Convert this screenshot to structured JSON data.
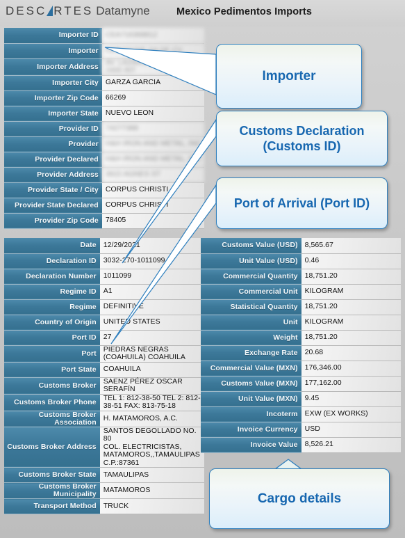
{
  "header": {
    "logo_primary": "DESC",
    "logo_triangle": "A",
    "logo_primary_tail": "RTES",
    "logo_secondary": "Datamyne",
    "title": "Mexico Pedimentos Imports"
  },
  "table_importer": {
    "rows": [
      {
        "label": "Importer ID",
        "value": "CEA716368812",
        "redacted": true
      },
      {
        "label": "Importer",
        "value": "CERADYNE SA DE CV",
        "redacted": true
      },
      {
        "label": "Importer Address",
        "value": "AV. LAZARO CARDENAS 2400 INT",
        "redacted": true
      },
      {
        "label": "Importer City",
        "value": "GARZA GARCIA",
        "redacted": false
      },
      {
        "label": "Importer Zip Code",
        "value": "66269",
        "redacted": false
      },
      {
        "label": "Importer State",
        "value": "NUEVO LEON",
        "redacted": false
      },
      {
        "label": "Provider ID",
        "value": "74277388",
        "redacted": true
      },
      {
        "label": "Provider",
        "value": "H&H IRON AND METAL, INC",
        "redacted": true
      },
      {
        "label": "Provider Declared",
        "value": "H&H IRON AND METAL, INC",
        "redacted": true
      },
      {
        "label": "Provider Address",
        "value": "3622 AGNES ST",
        "redacted": true
      },
      {
        "label": "Provider State / City",
        "value": "CORPUS CHRISTI",
        "redacted": false
      },
      {
        "label": "Provider State Declared",
        "value": "CORPUS CHRISTI",
        "redacted": false
      },
      {
        "label": "Provider Zip Code",
        "value": "78405",
        "redacted": false
      }
    ]
  },
  "table_declaration": {
    "rows": [
      {
        "label": "Date",
        "value": "12/29/2021"
      },
      {
        "label": "Declaration ID",
        "value": "3032-270-1011099"
      },
      {
        "label": "Declaration Number",
        "value": "1011099"
      },
      {
        "label": "Regime ID",
        "value": "A1"
      },
      {
        "label": "Regime",
        "value": "DEFINITIVE"
      },
      {
        "label": "Country of Origin",
        "value": "UNITED STATES"
      },
      {
        "label": "Port ID",
        "value": "27"
      },
      {
        "label": "Port",
        "value": "PIEDRAS NEGRAS\n(COAHUILA) COAHUILA"
      },
      {
        "label": "Port State",
        "value": "COAHUILA"
      },
      {
        "label": "Customs Broker",
        "value": "SAENZ PÉREZ OSCAR\nSERAFÍN"
      },
      {
        "label": "Customs Broker Phone",
        "value": "TEL 1: 812-38-50 TEL 2: 812-\n38-51 FAX: 813-75-18"
      },
      {
        "label": "Customs Broker Association",
        "value": "H. MATAMOROS, A.C."
      },
      {
        "label": "Customs Broker Address",
        "value": "SANTOS DEGOLLADO NO. 80\nCOL. ELECTRICISTAS,\nMATAMOROS,,TAMAULIPAS\nC.P.:87361"
      },
      {
        "label": "Customs Broker State",
        "value": "TAMAULIPAS"
      },
      {
        "label": "Customs Broker\nMunicipality",
        "value": "MATAMOROS"
      },
      {
        "label": "Transport Method",
        "value": "TRUCK"
      }
    ]
  },
  "table_cargo": {
    "rows": [
      {
        "label": "Customs Value (USD)",
        "value": "8,565.67"
      },
      {
        "label": "Unit Value (USD)",
        "value": "0.46"
      },
      {
        "label": "Commercial Quantity",
        "value": "18,751.20"
      },
      {
        "label": "Commercial Unit",
        "value": "KILOGRAM"
      },
      {
        "label": "Statistical Quantity",
        "value": "18,751.20"
      },
      {
        "label": "Unit",
        "value": "KILOGRAM"
      },
      {
        "label": "Weight",
        "value": "18,751.20"
      },
      {
        "label": "Exchange Rate",
        "value": "20.68"
      },
      {
        "label": "Commercial Value (MXN)",
        "value": "176,346.00"
      },
      {
        "label": "Customs Value (MXN)",
        "value": "177,162.00"
      },
      {
        "label": "Unit Value (MXN)",
        "value": "9.45"
      },
      {
        "label": "Incoterm",
        "value": "EXW (EX WORKS)"
      },
      {
        "label": "Invoice Currency",
        "value": "USD"
      },
      {
        "label": "Invoice Value",
        "value": "8,526.21"
      }
    ]
  },
  "callouts": [
    {
      "id": "importer",
      "text": "Importer"
    },
    {
      "id": "customs",
      "text": "Customs Declaration\n(Customs ID)"
    },
    {
      "id": "port",
      "text": "Port of Arrival (Port ID)"
    },
    {
      "id": "cargo",
      "text": "Cargo details"
    }
  ],
  "colors": {
    "label_blue": "#3c7899",
    "callout_border": "#2e7fbe",
    "callout_text": "#1767b0",
    "page_background": "#c9c9c9"
  }
}
